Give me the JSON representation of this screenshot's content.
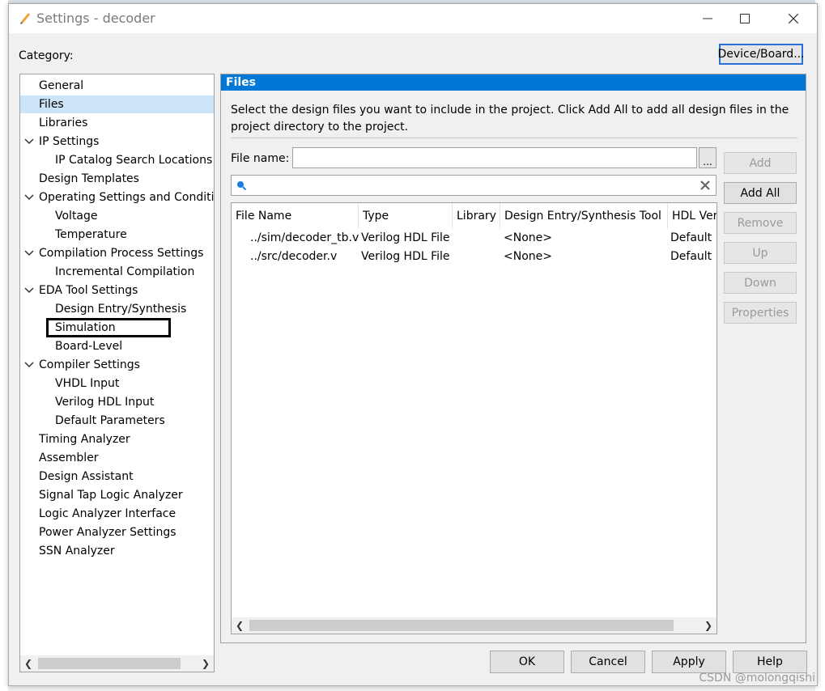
{
  "window": {
    "title": "Settings - decoder"
  },
  "header": {
    "category_label": "Category:",
    "device_button": "Device/Board..."
  },
  "tree": {
    "items": [
      {
        "label": "General",
        "level": 0,
        "expandable": false,
        "selected": false
      },
      {
        "label": "Files",
        "level": 0,
        "expandable": false,
        "selected": true
      },
      {
        "label": "Libraries",
        "level": 0,
        "expandable": false,
        "selected": false
      },
      {
        "label": "IP Settings",
        "level": 0,
        "expandable": true,
        "selected": false
      },
      {
        "label": "IP Catalog Search Locations",
        "level": 1,
        "expandable": false,
        "selected": false
      },
      {
        "label": "Design Templates",
        "level": 0,
        "expandable": false,
        "selected": false
      },
      {
        "label": "Operating Settings and Conditions",
        "level": 0,
        "expandable": true,
        "selected": false
      },
      {
        "label": "Voltage",
        "level": 1,
        "expandable": false,
        "selected": false
      },
      {
        "label": "Temperature",
        "level": 1,
        "expandable": false,
        "selected": false
      },
      {
        "label": "Compilation Process Settings",
        "level": 0,
        "expandable": true,
        "selected": false
      },
      {
        "label": "Incremental Compilation",
        "level": 1,
        "expandable": false,
        "selected": false
      },
      {
        "label": "EDA Tool Settings",
        "level": 0,
        "expandable": true,
        "selected": false
      },
      {
        "label": "Design Entry/Synthesis",
        "level": 1,
        "expandable": false,
        "selected": false
      },
      {
        "label": "Simulation",
        "level": 1,
        "expandable": false,
        "selected": false
      },
      {
        "label": "Board-Level",
        "level": 1,
        "expandable": false,
        "selected": false
      },
      {
        "label": "Compiler Settings",
        "level": 0,
        "expandable": true,
        "selected": false
      },
      {
        "label": "VHDL Input",
        "level": 1,
        "expandable": false,
        "selected": false
      },
      {
        "label": "Verilog HDL Input",
        "level": 1,
        "expandable": false,
        "selected": false
      },
      {
        "label": "Default Parameters",
        "level": 1,
        "expandable": false,
        "selected": false
      },
      {
        "label": "Timing Analyzer",
        "level": 0,
        "expandable": false,
        "selected": false
      },
      {
        "label": "Assembler",
        "level": 0,
        "expandable": false,
        "selected": false
      },
      {
        "label": "Design Assistant",
        "level": 0,
        "expandable": false,
        "selected": false
      },
      {
        "label": "Signal Tap Logic Analyzer",
        "level": 0,
        "expandable": false,
        "selected": false
      },
      {
        "label": "Logic Analyzer Interface",
        "level": 0,
        "expandable": false,
        "selected": false
      },
      {
        "label": "Power Analyzer Settings",
        "level": 0,
        "expandable": false,
        "selected": false
      },
      {
        "label": "SSN Analyzer",
        "level": 0,
        "expandable": false,
        "selected": false
      }
    ]
  },
  "files": {
    "heading": "Files",
    "description": "Select the design files you want to include in the project. Click Add All to add all design files in the project directory to the project.",
    "file_name_label": "File name:",
    "file_name_value": "",
    "browse_label": "...",
    "search_value": "",
    "columns": [
      "File Name",
      "Type",
      "Library",
      "Design Entry/Synthesis Tool",
      "HDL Version"
    ],
    "rows": [
      [
        "../sim/decoder_tb.v",
        "Verilog HDL File",
        "",
        "<None>",
        "Default"
      ],
      [
        "../src/decoder.v",
        "Verilog HDL File",
        "",
        "<None>",
        "Default"
      ]
    ],
    "buttons": {
      "add": "Add",
      "add_all": "Add All",
      "remove": "Remove",
      "up": "Up",
      "down": "Down",
      "properties": "Properties"
    }
  },
  "footer": {
    "ok": "OK",
    "cancel": "Cancel",
    "apply": "Apply",
    "help": "Help"
  },
  "watermark": "CSDN @molongqishi",
  "colors": {
    "accent": "#0078d7",
    "selected": "#cce4f7",
    "annotation": "#000000"
  }
}
